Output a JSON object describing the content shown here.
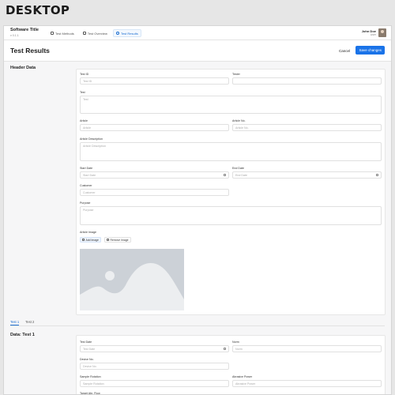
{
  "banner": "DESKTOP",
  "app": {
    "title": "Software Title",
    "version": "v 0.1.1"
  },
  "nav": {
    "tabs": [
      {
        "label": "Test Methods",
        "active": false
      },
      {
        "label": "Test Overview",
        "active": false
      },
      {
        "label": "Test Results",
        "active": true
      }
    ]
  },
  "user": {
    "name": "John Doe",
    "role": "User"
  },
  "page": {
    "title": "Test Results",
    "cancel": "Cancel",
    "save": "Save changes"
  },
  "header_section": {
    "title": "Header Data",
    "fields": {
      "test_id": {
        "label": "Test ID",
        "placeholder": "Test ID"
      },
      "tester": {
        "label": "Tester",
        "placeholder": ""
      },
      "test": {
        "label": "Test",
        "placeholder": "Test"
      },
      "article": {
        "label": "Article",
        "placeholder": "Article"
      },
      "article_no": {
        "label": "Article No.",
        "placeholder": "Article No."
      },
      "article_description": {
        "label": "Article Description",
        "placeholder": "Article Description"
      },
      "start_date": {
        "label": "Start Date",
        "placeholder": "Start Date"
      },
      "end_date": {
        "label": "End Date",
        "placeholder": "End Date"
      },
      "customer": {
        "label": "Customer",
        "placeholder": "Customer"
      },
      "purpose": {
        "label": "Purpose",
        "placeholder": "Purpose"
      }
    },
    "article_image": {
      "label": "Article Image",
      "add": "Add Image",
      "remove": "Remove Image"
    }
  },
  "test_tabs": [
    {
      "label": "Test 1",
      "active": true
    },
    {
      "label": "Test 2",
      "active": false
    }
  ],
  "data_section": {
    "title": "Data: Test 1",
    "fields": {
      "test_date": {
        "label": "Test Date",
        "placeholder": "Test Date"
      },
      "norm": {
        "label": "Norm",
        "placeholder": "Norm"
      },
      "device_no": {
        "label": "Device No.",
        "placeholder": "Device No."
      },
      "sample_rotation": {
        "label": "Sample Rotation",
        "placeholder": "Sample Rotation"
      },
      "abrasive_power": {
        "label": "Abrasive Power",
        "placeholder": "Abrasive Power"
      },
      "target_abr_flow": {
        "label": "Target Abr. Flow"
      }
    }
  },
  "colors": {
    "accent": "#1a73e8",
    "background": "#f6f6f7",
    "card": "#ffffff",
    "image_placeholder": "#ccd1d7"
  }
}
